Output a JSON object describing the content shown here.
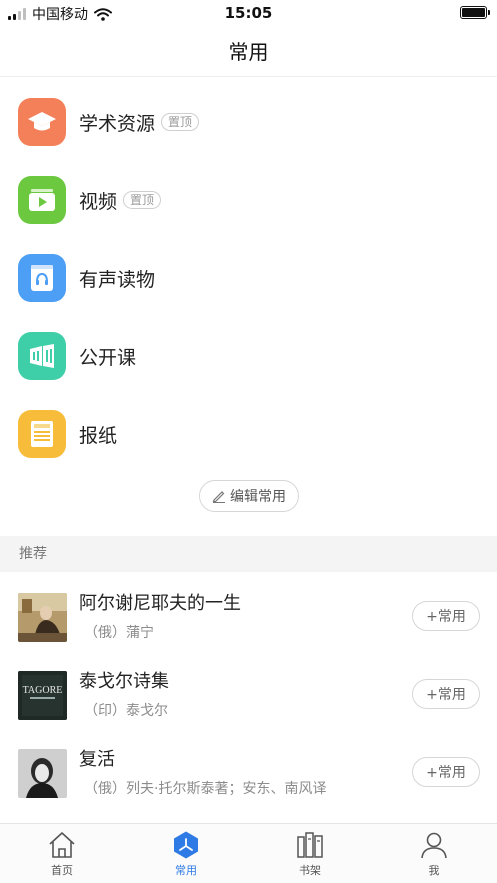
{
  "status_bar": {
    "carrier": "中国移动",
    "time": "15:05"
  },
  "nav": {
    "title": "常用"
  },
  "frequent_items": [
    {
      "label": "学术资源",
      "tag": "置顶",
      "color": "#f4805a",
      "icon": "graduation-cap-icon"
    },
    {
      "label": "视频",
      "tag": "置顶",
      "color": "#6cc93f",
      "icon": "video-play-icon"
    },
    {
      "label": "有声读物",
      "tag": "",
      "color": "#4d9ef5",
      "icon": "headphones-book-icon"
    },
    {
      "label": "公开课",
      "tag": "",
      "color": "#3ecfa9",
      "icon": "open-course-icon"
    },
    {
      "label": "报纸",
      "tag": "",
      "color": "#f7bd3a",
      "icon": "newspaper-icon"
    }
  ],
  "edit_button": {
    "label": "编辑常用"
  },
  "recommend": {
    "header": "推荐",
    "add_label": "+常用",
    "books": [
      {
        "title": "阿尔谢尼耶夫的一生",
        "author": "（俄）蒲宁"
      },
      {
        "title": "泰戈尔诗集",
        "author": "（印）泰戈尔",
        "cover_text": "TAGORE"
      },
      {
        "title": "复活",
        "author": "（俄）列夫·托尔斯泰著；安东、南风译"
      }
    ]
  },
  "tabs": [
    {
      "label": "首页",
      "icon": "home-icon"
    },
    {
      "label": "常用",
      "icon": "frequent-hexagon-icon",
      "active": true
    },
    {
      "label": "书架",
      "icon": "bookshelf-icon"
    },
    {
      "label": "我",
      "icon": "user-icon"
    }
  ],
  "colors": {
    "accent": "#2f7be5"
  }
}
